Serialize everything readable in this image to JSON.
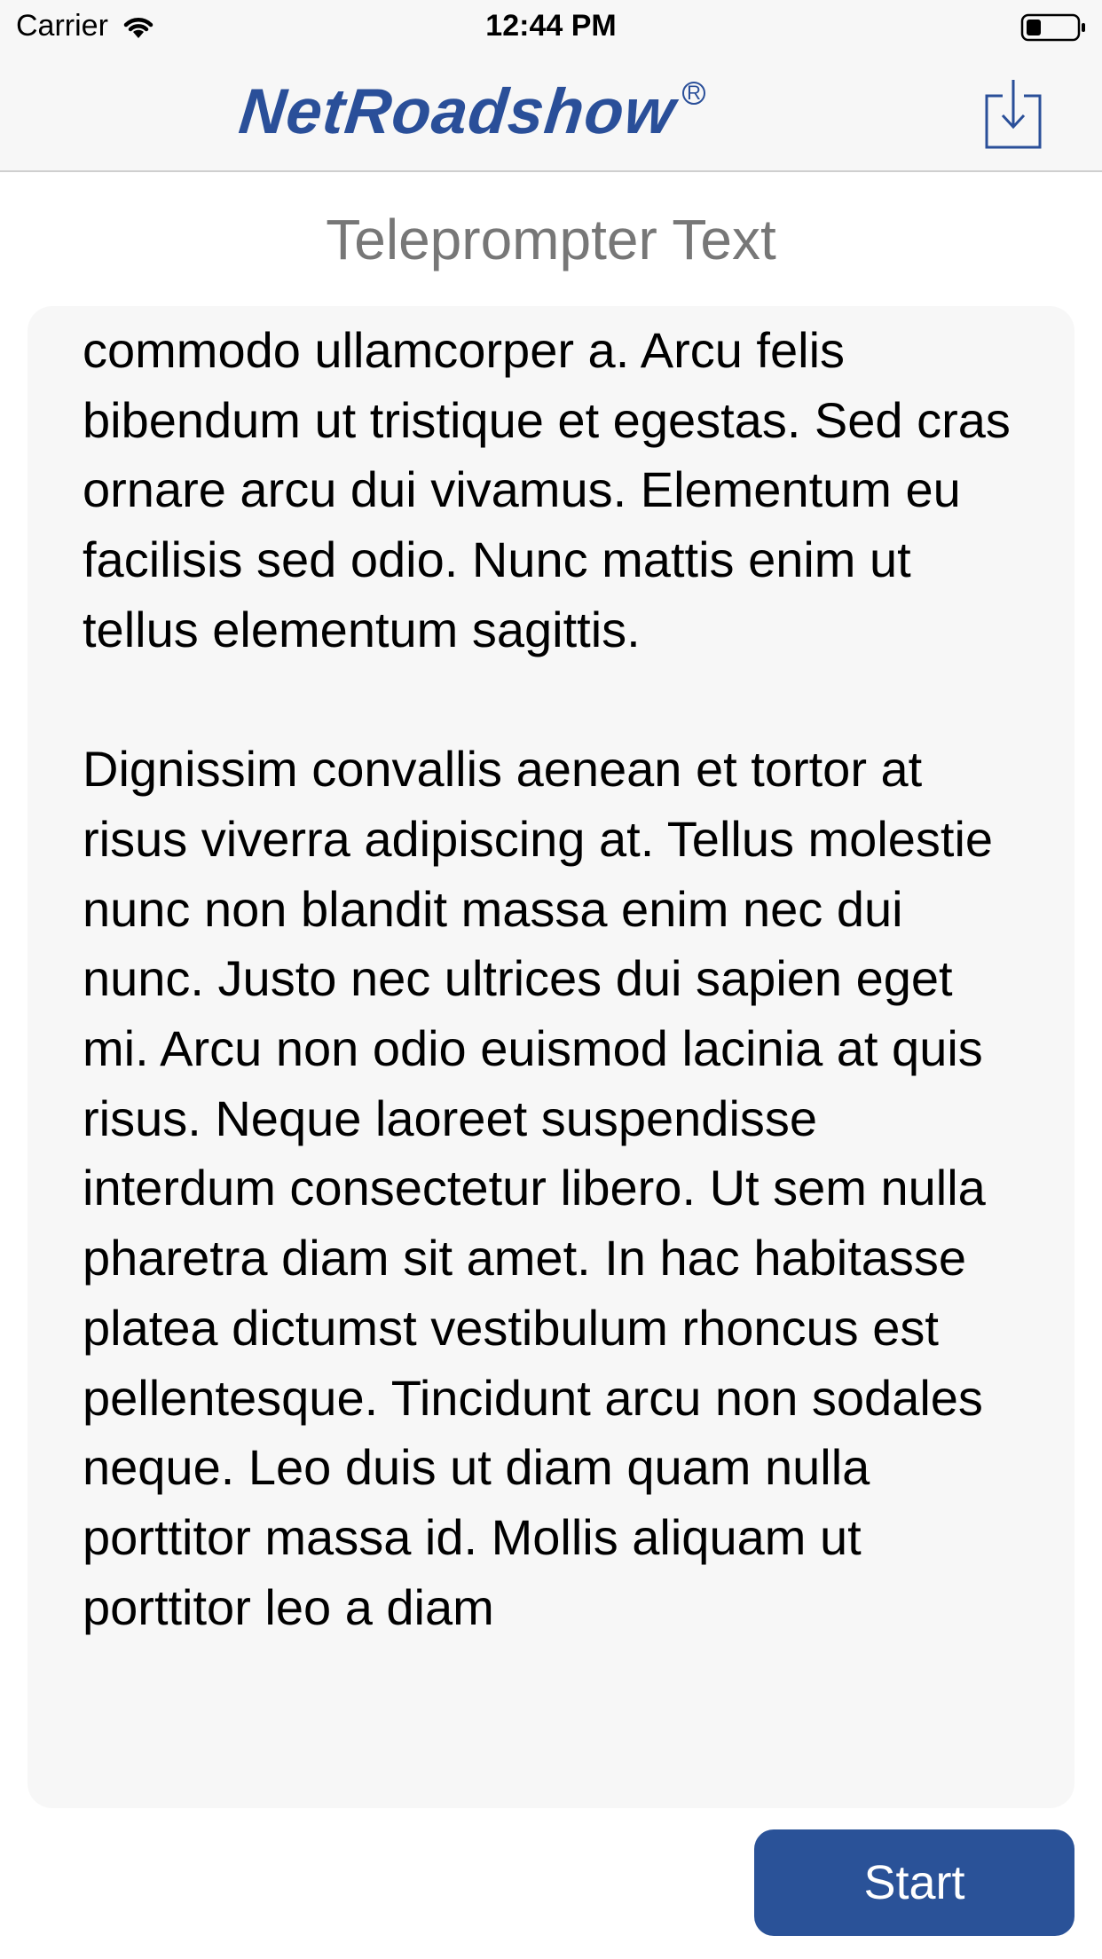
{
  "status_bar": {
    "carrier": "Carrier",
    "time": "12:44 PM"
  },
  "header": {
    "logo_text": "NetRoadshow",
    "logo_reg": "R",
    "brand_color": "#2a4f99",
    "download_icon": "download-icon"
  },
  "page": {
    "title": "Teleprompter Text"
  },
  "teleprompter": {
    "paragraph_1": "commodo ullamcorper a. Arcu felis bibendum ut tristique et egestas. Sed cras ornare arcu dui vivamus. Elementum eu facilisis sed odio. Nunc mattis enim ut tellus elementum sagittis.",
    "paragraph_2": "Dignissim convallis aenean et tortor at risus viverra adipiscing at. Tellus molestie nunc non blandit massa enim nec dui nunc. Justo nec ultrices dui sapien eget mi. Arcu non odio euismod lacinia at quis risus. Neque laoreet suspendisse interdum consectetur libero. Ut sem nulla pharetra diam sit amet. In hac habitasse platea dictumst vestibulum rhoncus est pellentesque. Tincidunt arcu non sodales neque. Leo duis ut diam quam nulla porttitor massa id. Mollis aliquam ut porttitor leo a diam"
  },
  "actions": {
    "start_label": "Start",
    "button_color": "#2a5298"
  }
}
